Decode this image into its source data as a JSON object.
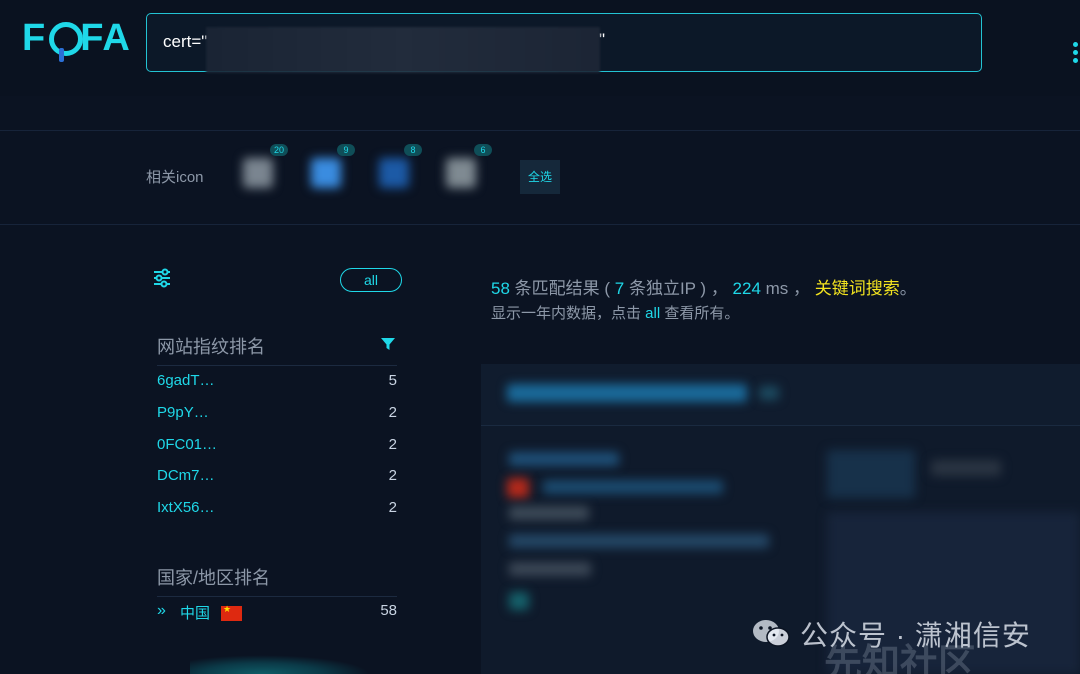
{
  "header": {
    "logo": "FOFA",
    "search": {
      "value": "cert=\"",
      "trailing": "\""
    }
  },
  "icons_bar": {
    "label": "相关icon",
    "counts": [
      "20",
      "9",
      "8",
      "6"
    ],
    "select_all": "全选"
  },
  "filters": {
    "all_label": "all"
  },
  "fingerprint": {
    "title": "网站指纹排名",
    "items": [
      {
        "name": "6gadT…",
        "count": "5"
      },
      {
        "name": "P9pY…",
        "count": "2"
      },
      {
        "name": "0FC01…",
        "count": "2"
      },
      {
        "name": "DCm7…",
        "count": "2"
      },
      {
        "name": "IxtX56…",
        "count": "2"
      }
    ]
  },
  "country": {
    "title": "国家/地区排名",
    "items": [
      {
        "name": "中国",
        "count": "58"
      }
    ]
  },
  "summary": {
    "count": "58",
    "count_suffix": " 条匹配结果 ( ",
    "ip_count": "7",
    "ip_suffix": " 条独立IP ) ， ",
    "ms": "224",
    "ms_suffix": " ms ， ",
    "keyword": "关键词搜索",
    "end": "。",
    "line2_pre": "显示一年内数据，点击 ",
    "line2_link": "all",
    "line2_post": " 查看所有。"
  },
  "watermark": {
    "text": "公众号 · 潇湘信安",
    "text2": "先知社区"
  },
  "colors": {
    "accent": "#1fd8e8",
    "keyword": "#f2e31f",
    "background": "#0b1322"
  }
}
